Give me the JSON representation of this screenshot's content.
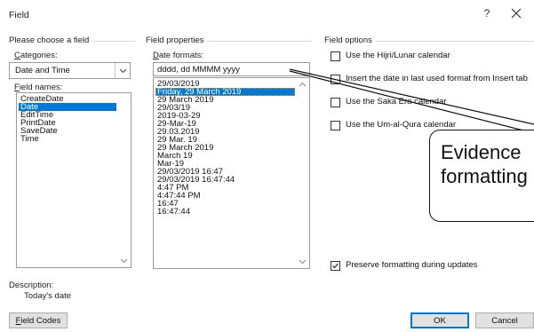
{
  "window": {
    "title": "Field",
    "help_label": "?",
    "close_icon": "close-icon"
  },
  "left": {
    "group_label": "Please choose a field",
    "categories_label": "Categories:",
    "category_value": "Date and Time",
    "field_names_label": "Field names:",
    "field_names": [
      "CreateDate",
      "Date",
      "EditTime",
      "PrintDate",
      "SaveDate",
      "Time"
    ],
    "selected_field": "Date"
  },
  "middle": {
    "group_label": "Field properties",
    "date_formats_label": "Date formats:",
    "format_value": "dddd, dd MMMM yyyy",
    "formats": [
      "29/03/2019",
      "Friday, 29 March 2019",
      "29 March 2019",
      "29/03/19",
      "2019-03-29",
      "29-Mar-19",
      "29.03.2019",
      "29 Mar. 19",
      "29 March 2019",
      "March 19",
      "Mar-19",
      "29/03/2019 16:47",
      "29/03/2019 16:47:44",
      "4:47 PM",
      "4:47:44 PM",
      "16:47",
      "16:47:44"
    ],
    "selected_format": "Friday, 29 March 2019"
  },
  "right": {
    "group_label": "Field options",
    "options": [
      {
        "label": "Use the Hijri/Lunar calendar",
        "checked": false
      },
      {
        "label": "Insert the date in last used format from Insert tab",
        "checked": false
      },
      {
        "label": "Use the Saka Era calendar",
        "checked": false
      },
      {
        "label": "Use the Um-al-Qura calendar",
        "checked": false
      }
    ],
    "preserve_label": "Preserve formatting during updates",
    "preserve_checked": true
  },
  "description": {
    "label": "Description:",
    "text": "Today's date"
  },
  "buttons": {
    "field_codes": "Field Codes",
    "ok": "OK",
    "cancel": "Cancel"
  },
  "annotation": {
    "text": "Evidence\nformatting"
  }
}
